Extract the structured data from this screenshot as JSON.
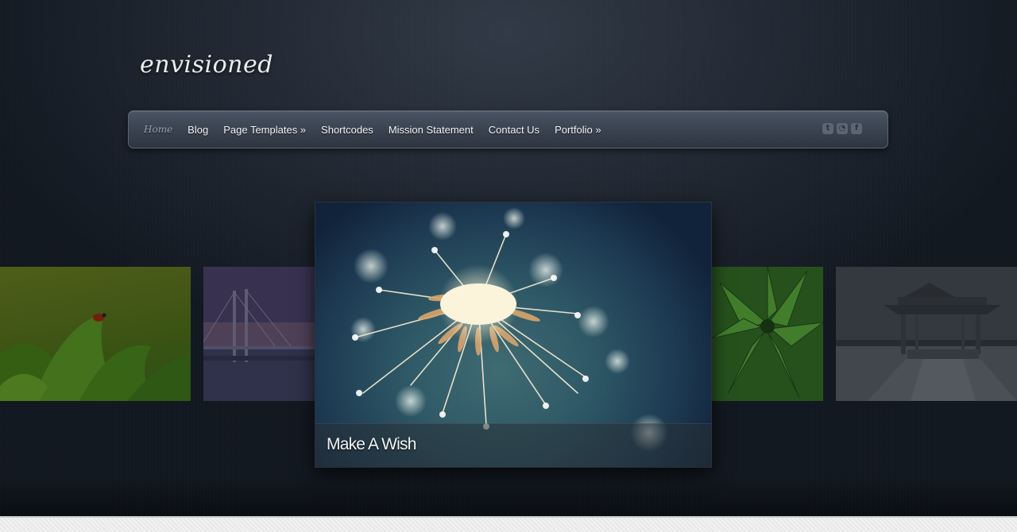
{
  "site": {
    "logo": "envisioned"
  },
  "nav": {
    "items": [
      {
        "label": "Home",
        "active": true
      },
      {
        "label": "Blog"
      },
      {
        "label": "Page Templates »"
      },
      {
        "label": "Shortcodes"
      },
      {
        "label": "Mission Statement"
      },
      {
        "label": "Contact Us"
      },
      {
        "label": "Portfolio »"
      }
    ],
    "social": [
      {
        "icon": "twitter-icon",
        "glyph": "t"
      },
      {
        "icon": "rss-icon",
        "glyph": "◔"
      },
      {
        "icon": "facebook-icon",
        "glyph": "f"
      }
    ]
  },
  "slider": {
    "active_caption": "Make A Wish",
    "slides": [
      {
        "name": "ladybug-leaves"
      },
      {
        "name": "bridge-dusk"
      },
      {
        "name": "dandelion"
      },
      {
        "name": "green-plant"
      },
      {
        "name": "pier-gazebo"
      }
    ]
  },
  "colors": {
    "background": "#1b222c",
    "nav_bg": "#3a4350",
    "nav_text": "#f3f5f7",
    "nav_active": "#9aa3ae"
  }
}
